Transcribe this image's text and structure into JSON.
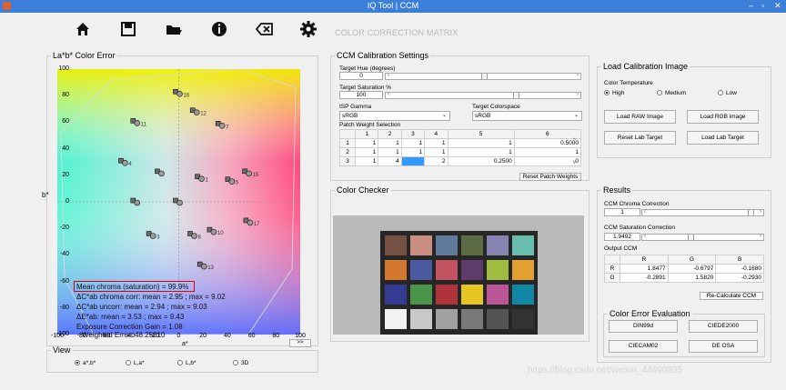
{
  "window": {
    "title": "IQ Tool | CCM"
  },
  "app_name": "COLOR CORRECTION MATRIX",
  "toolbar": {
    "icons": [
      "home-icon",
      "save-icon",
      "folder-open-icon",
      "info-icon",
      "backspace-icon",
      "gear-icon"
    ]
  },
  "plot_panel": {
    "legend": "La*b* Color Error",
    "y_ticks": [
      "100",
      "80",
      "60",
      "40",
      "20",
      "0",
      "-20",
      "-40",
      "-60",
      "-80",
      "-100"
    ],
    "x_ticks": [
      "-100",
      "-80",
      "-60",
      "-40",
      "-20",
      "0",
      "20",
      "40",
      "60",
      "80",
      "100"
    ],
    "x_label": "a*",
    "y_label": "b*",
    "annotations": {
      "mean_chroma": "Mean chroma (saturation) = 99.9%",
      "corr": "ΔC*ab chroma corr: mean = 2.95 ; max = 9.02",
      "uncorr": "ΔC*ab uncorr: mean = 2.94 ; max = 9.03",
      "deltaE": "ΔE*ab: mean = 3.53 ; max = 9.43",
      "gain": "Exposure Correction Gain = 1.08",
      "weighted": "Weighted Error: 48.25010"
    },
    "next_button": ">>"
  },
  "chart_data": {
    "type": "scatter",
    "xlabel": "a*",
    "ylabel": "b*",
    "xlim": [
      -100,
      100
    ],
    "ylim": [
      -100,
      100
    ],
    "points": [
      {
        "x": -35,
        "y": 60,
        "label": "11"
      },
      {
        "x": -45,
        "y": 30,
        "label": "4"
      },
      {
        "x": -15,
        "y": 22,
        "label": ""
      },
      {
        "x": -35,
        "y": 0,
        "label": ""
      },
      {
        "x": 0,
        "y": 82,
        "label": "16"
      },
      {
        "x": 14,
        "y": 68,
        "label": "12"
      },
      {
        "x": 35,
        "y": 58,
        "label": "7"
      },
      {
        "x": 18,
        "y": 18,
        "label": "1"
      },
      {
        "x": 43,
        "y": 16,
        "label": "5"
      },
      {
        "x": 57,
        "y": 22,
        "label": "15"
      },
      {
        "x": 0,
        "y": 0,
        "label": ""
      },
      {
        "x": -22,
        "y": -25,
        "label": "3"
      },
      {
        "x": 12,
        "y": -25,
        "label": "8"
      },
      {
        "x": 28,
        "y": -22,
        "label": "10"
      },
      {
        "x": 58,
        "y": -15,
        "label": "17"
      },
      {
        "x": 20,
        "y": -48,
        "label": "13"
      }
    ]
  },
  "view": {
    "legend": "View",
    "options": [
      "a*,b*",
      "L,a*",
      "L,b*",
      "3D"
    ],
    "selected": "a*,b*"
  },
  "calib": {
    "legend": "CCM Calibration Settings",
    "hue_label": "Target Hue (degrees)",
    "hue_value": "0",
    "sat_label": "Target Saturation %",
    "sat_value": "100",
    "gamma_label": "ISP Gamma",
    "gamma_value": "sRGB",
    "colorspace_label": "Target Colorspace",
    "colorspace_value": "sRGB",
    "weights_label": "Patch Weight Selection",
    "columns": [
      "1",
      "2",
      "3",
      "4",
      "5",
      "6"
    ],
    "rows": [
      {
        "idx": "1",
        "cells": [
          "1",
          "1",
          "1",
          "1",
          "1",
          "0.5000"
        ]
      },
      {
        "idx": "2",
        "cells": [
          "1",
          "1",
          "1",
          "1",
          "1",
          "1"
        ]
      },
      {
        "idx": "3",
        "cells": [
          "1",
          "4",
          "4",
          "2",
          "0.2500",
          "0"
        ]
      }
    ],
    "reset_button": "Reset Patch Weights"
  },
  "load": {
    "legend": "Load Calibration Image",
    "temp_label": "Color Temperature",
    "temps": [
      "High",
      "Medium",
      "Low"
    ],
    "temp_selected": "High",
    "buttons": [
      "Load RAW Image",
      "Load RGB image",
      "Reset Lab Target",
      "Load Lab Target"
    ]
  },
  "checker": {
    "legend": "Color Checker",
    "patches": [
      "#765043",
      "#c98f80",
      "#5f7c9c",
      "#5b6c42",
      "#8784b2",
      "#67bdae",
      "#d3782e",
      "#4b5aa0",
      "#c1525f",
      "#5e3b6b",
      "#9dbc40",
      "#e2a032",
      "#353b90",
      "#499549",
      "#b0333b",
      "#e4c521",
      "#bc5595",
      "#0f86a4",
      "#f2f2f2",
      "#c9c9c9",
      "#a0a0a0",
      "#797979",
      "#545454",
      "#333333"
    ]
  },
  "results": {
    "legend": "Results",
    "chroma_label": "CCM Chroma Correction",
    "chroma_value": "1",
    "sat_label": "CCM Saturation Correction",
    "sat_value": "1.9492",
    "output_label": "Output CCM",
    "columns": [
      "R",
      "G",
      "B"
    ],
    "rows": [
      {
        "idx": "R",
        "cells": [
          "1.8477",
          "-0.6797",
          "-0.1680"
        ]
      },
      {
        "idx": "G",
        "cells": [
          "-0.2891",
          "1.5820",
          "-0.2930"
        ]
      }
    ],
    "recalc_button": "Re-Calculate CCM"
  },
  "eval": {
    "legend": "Color Error Evaluation",
    "buttons": [
      "DIN99d",
      "CIEDE2000",
      "CIECAM02",
      "DE OSA"
    ]
  },
  "watermark": "https://blog.csdn.net/weixin_44690935"
}
